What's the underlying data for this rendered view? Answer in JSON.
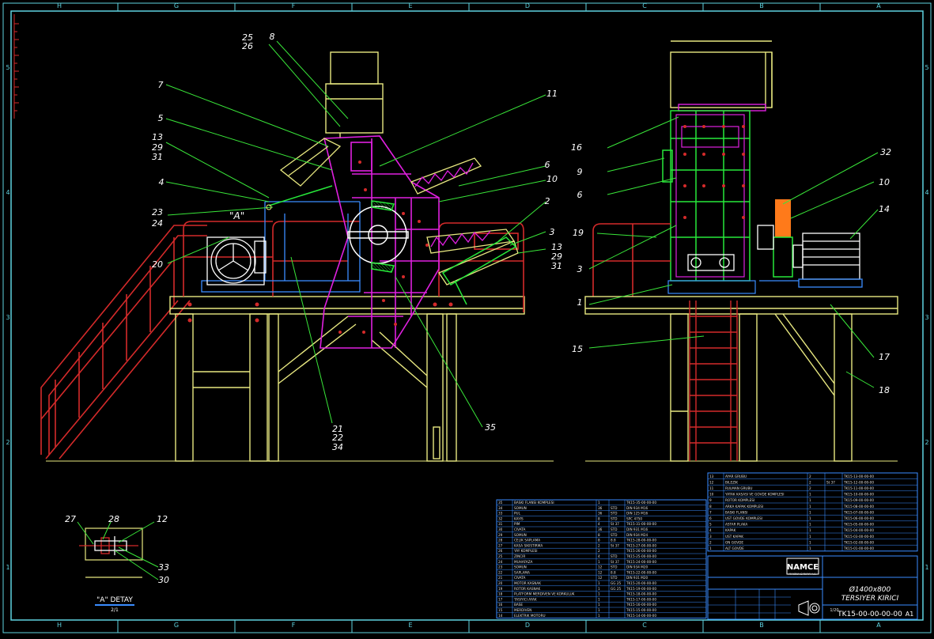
{
  "colors": {
    "background": "#000000",
    "border": "#5fd3e0",
    "leader": "#39e639",
    "label": "#ffffff",
    "frame": "#e8e880",
    "red": "#d42a2a",
    "magenta": "#e020e0",
    "green": "#27e83a",
    "white": "#ffffff",
    "orange": "#ff7a1a",
    "table_line": "#3a8cff",
    "table_text": "#e0e0e0"
  },
  "border": {
    "columns": [
      "H",
      "G",
      "F",
      "E",
      "D",
      "C",
      "B",
      "A"
    ],
    "rows": [
      "5",
      "4",
      "3",
      "2",
      "1"
    ]
  },
  "callouts_left": [
    {
      "text": "25"
    },
    {
      "text": "26"
    },
    {
      "text": "8"
    },
    {
      "text": "7"
    },
    {
      "text": "5"
    },
    {
      "text": "13"
    },
    {
      "text": "29"
    },
    {
      "text": "31"
    },
    {
      "text": "4"
    },
    {
      "text": "23"
    },
    {
      "text": "24"
    },
    {
      "text": "20"
    },
    {
      "text": "11"
    },
    {
      "text": "6"
    },
    {
      "text": "10"
    },
    {
      "text": "2"
    },
    {
      "text": "3"
    },
    {
      "text": "13"
    },
    {
      "text": "29"
    },
    {
      "text": "31"
    },
    {
      "text": "21"
    },
    {
      "text": "22"
    },
    {
      "text": "34"
    },
    {
      "text": "35"
    }
  ],
  "callouts_right": [
    {
      "text": "16"
    },
    {
      "text": "9"
    },
    {
      "text": "6"
    },
    {
      "text": "32"
    },
    {
      "text": "10"
    },
    {
      "text": "14"
    },
    {
      "text": "19"
    },
    {
      "text": "3"
    },
    {
      "text": "1"
    },
    {
      "text": "15"
    },
    {
      "text": "17"
    },
    {
      "text": "18"
    }
  ],
  "detail": {
    "marker": "\"A\"",
    "title": "\"A\" DETAY",
    "scale": "2/1",
    "callouts": [
      {
        "text": "27"
      },
      {
        "text": "28"
      },
      {
        "text": "12"
      },
      {
        "text": "33"
      },
      {
        "text": "30"
      }
    ]
  },
  "bom_left": [
    {
      "no": "35",
      "name": "BASKI FLANSI KOMPLESI",
      "qty": "1",
      "mat": "",
      "code": "TK15-35-00-00-00"
    },
    {
      "no": "34",
      "name": "SOMUN",
      "qty": "36",
      "mat": "STD",
      "code": "DIN 934 M16"
    },
    {
      "no": "33",
      "name": "PUL",
      "qty": "36",
      "mat": "STD",
      "code": "DIN 125 M16"
    },
    {
      "no": "32",
      "name": "KAYIS",
      "qty": "8",
      "mat": "STD",
      "code": "SPC 4750"
    },
    {
      "no": "31",
      "name": "PIM",
      "qty": "4",
      "mat": "St 37",
      "code": "TK15-31-00-00-00"
    },
    {
      "no": "30",
      "name": "CIVATA",
      "qty": "36",
      "mat": "STD",
      "code": "DIN 931 M16"
    },
    {
      "no": "29",
      "name": "SOMUN",
      "qty": "8",
      "mat": "STD",
      "code": "DIN 934 M24"
    },
    {
      "no": "28",
      "name": "CELIK SAPLAMA",
      "qty": "8",
      "mat": "8.8",
      "code": "TK15-28-00-00-00"
    },
    {
      "no": "27",
      "name": "KASA SIKISTIRMA",
      "qty": "2",
      "mat": "St 37",
      "code": "TK15-27-00-00-00"
    },
    {
      "no": "26",
      "name": "YAY KOMPLESI",
      "qty": "2",
      "mat": "",
      "code": "TK15-26-00-00-00"
    },
    {
      "no": "25",
      "name": "ZINCIR",
      "qty": "4",
      "mat": "STD",
      "code": "TK15-25-00-00-00"
    },
    {
      "no": "24",
      "name": "MUHAFAZA",
      "qty": "1",
      "mat": "St 37",
      "code": "TK15-24-00-00-00"
    },
    {
      "no": "23",
      "name": "SOMUN",
      "qty": "12",
      "mat": "STD",
      "code": "DIN 934 M20"
    },
    {
      "no": "22",
      "name": "SAPLAMA",
      "qty": "12",
      "mat": "8.8",
      "code": "TK15-22-00-00-00"
    },
    {
      "no": "21",
      "name": "CIVATA",
      "qty": "12",
      "mat": "STD",
      "code": "DIN 931 M20"
    },
    {
      "no": "20",
      "name": "MOTOR KASNAK",
      "qty": "1",
      "mat": "GG 25",
      "code": "TK15-20-00-00-00"
    },
    {
      "no": "19",
      "name": "ROTOR KASNAK",
      "qty": "1",
      "mat": "GG 25",
      "code": "TK15-19-00-00-00"
    },
    {
      "no": "18",
      "name": "PLATFORM MERDIVEN VE KORKULUK",
      "qty": "1",
      "mat": "",
      "code": "TK15-18-00-00-00"
    },
    {
      "no": "17",
      "name": "TASIYICI AYAK",
      "qty": "1",
      "mat": "",
      "code": "TK15-17-00-00-00"
    },
    {
      "no": "16",
      "name": "BASE",
      "qty": "1",
      "mat": "",
      "code": "TK15-16-00-00-00"
    },
    {
      "no": "15",
      "name": "MERDIVEN",
      "qty": "1",
      "mat": "",
      "code": "TK15-15-00-00-00"
    },
    {
      "no": "14",
      "name": "ELEKTRIK MOTORU",
      "qty": "1",
      "mat": "",
      "code": "TK15-14-00-00-00"
    }
  ],
  "bom_right": [
    {
      "no": "13",
      "name": "AYAR GRUBU",
      "qty": "2",
      "mat": "",
      "code": "TK15-13-00-00-00"
    },
    {
      "no": "12",
      "name": "BILEZIK",
      "qty": "2",
      "mat": "St 37",
      "code": "TK15-12-00-00-00"
    },
    {
      "no": "11",
      "name": "RULMAN GRUBU",
      "qty": "2",
      "mat": "",
      "code": "TK15-11-00-00-00"
    },
    {
      "no": "10",
      "name": "YATAK KASASI VE GOVDE KOMPLESI",
      "qty": "1",
      "mat": "",
      "code": "TK15-10-00-00-00"
    },
    {
      "no": "9",
      "name": "ROTOR KOMPLESI",
      "qty": "1",
      "mat": "",
      "code": "TK15-09-00-00-00"
    },
    {
      "no": "8",
      "name": "ARKA KAPAK KOMPLESI",
      "qty": "1",
      "mat": "",
      "code": "TK15-08-00-00-00"
    },
    {
      "no": "7",
      "name": "BASKI FLANSI",
      "qty": "1",
      "mat": "",
      "code": "TK15-07-00-00-00"
    },
    {
      "no": "6",
      "name": "UST GOVDE KOMPLESI",
      "qty": "1",
      "mat": "",
      "code": "TK15-06-00-00-00"
    },
    {
      "no": "5",
      "name": "ASTAR PLAKA",
      "qty": "1",
      "mat": "",
      "code": "TK15-05-00-00-00"
    },
    {
      "no": "4",
      "name": "KAPAK",
      "qty": "1",
      "mat": "",
      "code": "TK15-04-00-00-00"
    },
    {
      "no": "3",
      "name": "UST KAPAK",
      "qty": "1",
      "mat": "",
      "code": "TK15-03-00-00-00"
    },
    {
      "no": "2",
      "name": "ON GOVDE",
      "qty": "1",
      "mat": "",
      "code": "TK15-02-00-00-00"
    },
    {
      "no": "1",
      "name": "ALT GOVDE",
      "qty": "1",
      "mat": "",
      "code": "TK15-01-00-00-00"
    }
  ],
  "title_block": {
    "logo": "NAMCE",
    "logo_sub": "MAKINA SANAYI A.S.",
    "size": "Ø1400x800",
    "name": "TERSIYER KIRICI",
    "code": "TK15-00-00-00-00",
    "sheet": "A1",
    "scale": "1/20"
  }
}
